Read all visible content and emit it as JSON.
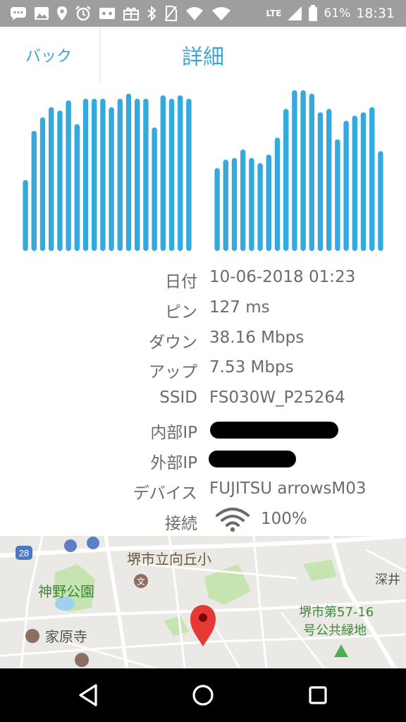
{
  "status_bar": {
    "network_type": "LTE",
    "battery_percent": "61%",
    "time": "18:31"
  },
  "header": {
    "back_label": "バック",
    "title": "詳細"
  },
  "colors": {
    "accent": "#3aa7d6",
    "bar": "#35a9dc",
    "status_bar_bg": "#9e9e9e",
    "nav_bar_bg": "#000000"
  },
  "chart_data": [
    {
      "type": "bar",
      "values": [
        0.42,
        0.71,
        0.79,
        0.85,
        0.83,
        0.89,
        0.75,
        0.9,
        0.9,
        0.9,
        0.85,
        0.9,
        0.93,
        0.9,
        0.9,
        0.73,
        0.92,
        0.9,
        0.92,
        0.9
      ]
    },
    {
      "type": "bar",
      "values": [
        0.49,
        0.54,
        0.55,
        0.6,
        0.55,
        0.52,
        0.57,
        0.67,
        0.84,
        0.95,
        0.95,
        0.93,
        0.82,
        0.84,
        0.66,
        0.77,
        0.8,
        0.82,
        0.85,
        0.59
      ]
    }
  ],
  "details": {
    "date": {
      "label": "日付",
      "value": "10-06-2018 01:23"
    },
    "ping": {
      "label": "ピン",
      "value": "127 ms"
    },
    "download": {
      "label": "ダウン",
      "value": "38.16 Mbps"
    },
    "upload": {
      "label": "アップ",
      "value": "7.53 Mbps"
    },
    "ssid": {
      "label": "SSID",
      "value": "FS030W_P25264"
    },
    "internal_ip": {
      "label": "内部IP"
    },
    "external_ip": {
      "label": "外部IP"
    },
    "device": {
      "label": "デバイス",
      "value": "FUJITSU arrowsM03"
    },
    "connection": {
      "label": "接続",
      "value": "100%",
      "icon": "wifi-icon"
    }
  },
  "map": {
    "labels": {
      "school": "堺市立向丘小",
      "park_kamino": "神野公園",
      "temple": "家原寺",
      "green_area": "堺市第57-16\n号公共緑地",
      "area_fukai": "深井",
      "road_number": "28"
    }
  }
}
